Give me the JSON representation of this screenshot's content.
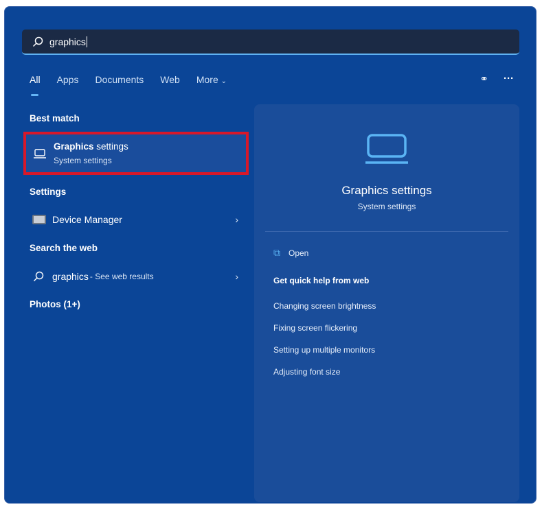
{
  "search": {
    "value": "graphics"
  },
  "tabs": [
    {
      "label": "All"
    },
    {
      "label": "Apps"
    },
    {
      "label": "Documents"
    },
    {
      "label": "Web"
    },
    {
      "label": "More"
    }
  ],
  "sections": {
    "best_match": "Best match",
    "settings": "Settings",
    "search_web": "Search the web",
    "photos": "Photos (1+)"
  },
  "best_match": {
    "title_bold": "Graphics",
    "title_rest": " settings",
    "subtitle": "System settings"
  },
  "settings_items": [
    {
      "label": "Device Manager"
    }
  ],
  "web_result": {
    "query": "graphics",
    "suffix": " - See web results"
  },
  "preview": {
    "title": "Graphics settings",
    "subtitle": "System settings",
    "open": "Open",
    "help_heading": "Get quick help from web",
    "help_links": [
      "Changing screen brightness",
      "Fixing screen flickering",
      "Setting up multiple monitors",
      "Adjusting font size"
    ]
  }
}
